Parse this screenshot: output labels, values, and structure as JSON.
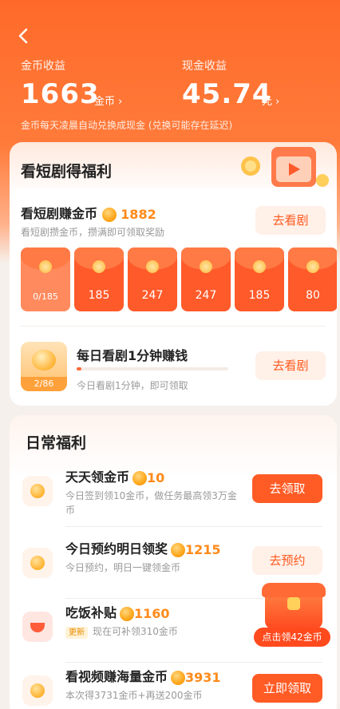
{
  "header": {
    "back_icon": "chevron-left-icon",
    "coin_earnings_label": "金币收益",
    "coin_earnings_value": "1663",
    "coin_earnings_unit": "金币 ›",
    "cash_earnings_label": "现金收益",
    "cash_earnings_value": "45.74",
    "cash_earnings_unit": "元 ›",
    "notice": "金币每天凌晨自动兑换成现金 (兑换可能存在延迟)"
  },
  "drama_section": {
    "title": "看短剧得福利",
    "earn_row": {
      "title": "看短剧赚金币",
      "coins": "1882",
      "subtitle": "看短剧攒金币，攒满即可领取奖励",
      "button": "去看剧"
    },
    "envelopes": [
      "0/185",
      "185",
      "247",
      "247",
      "185",
      "80"
    ],
    "daily_row": {
      "title": "每日看剧1分钟赚钱",
      "subtitle": "今日看剧1分钟，即可领取",
      "progress_label": "2/86",
      "progress_fraction": 0.03,
      "button": "去看剧"
    }
  },
  "daily_section": {
    "title": "日常福利",
    "tasks": [
      {
        "title": "天天领金币",
        "coins": "10",
        "desc": "今日签到领10金币，做任务最高领3万金币",
        "button": "去领取",
        "button_style": "solid",
        "icon": "coin-icon"
      },
      {
        "title": "今日预约明日领奖",
        "coins": "1215",
        "desc": "今日预约，明日一键领金币",
        "button": "去预约",
        "button_style": "light",
        "icon": "coin-icon"
      },
      {
        "title": "吃饭补贴",
        "coins": "1160",
        "tag": "更新",
        "desc": "现在可补领310金币",
        "button": "",
        "button_style": "solid",
        "icon": "bowl-icon"
      },
      {
        "title": "看视频赚海量金币",
        "coins": "3931",
        "desc": "本次得3731金币+再送200金币",
        "button": "立即领取",
        "button_style": "solid",
        "icon": "coin-icon"
      }
    ]
  },
  "floating_chest": {
    "label": "点击领42金币",
    "icon": "treasure-chest-icon"
  },
  "colors": {
    "brand_orange": "#ff5b25",
    "coin_gold": "#ff8a1a"
  }
}
